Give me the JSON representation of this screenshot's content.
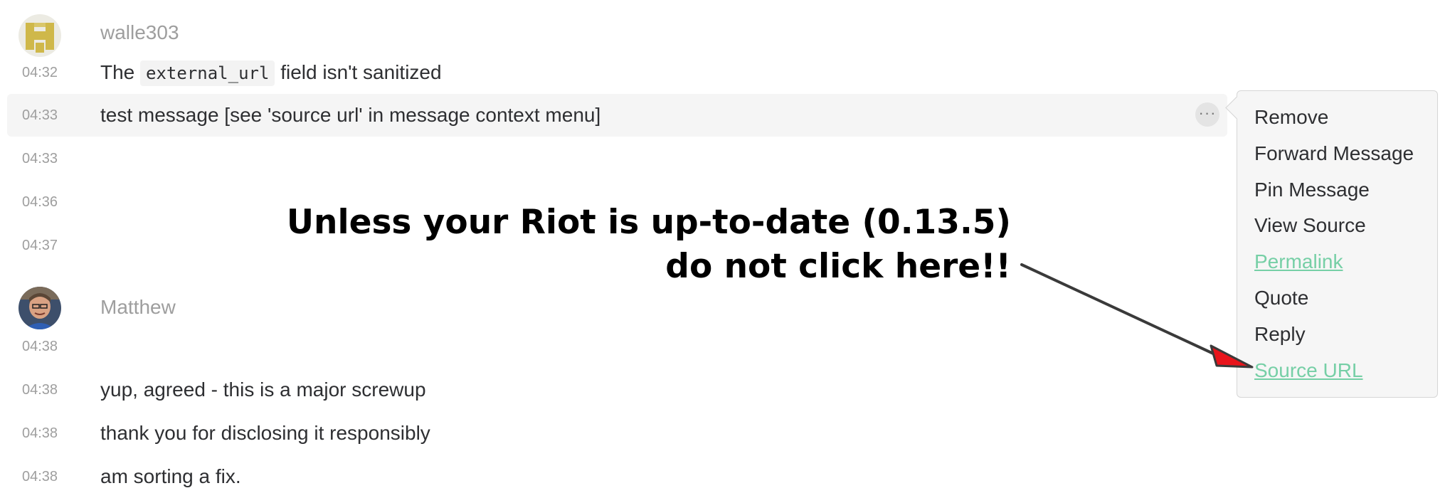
{
  "messages": {
    "group1": {
      "sender": "walle303",
      "rows": [
        {
          "time": "04:32",
          "text_before": "The ",
          "code": "external_url",
          "text_after": " field isn't sanitized"
        },
        {
          "time": "04:33",
          "text": "test message [see 'source url' in message context menu]"
        },
        {
          "time": "04:33",
          "text": ""
        },
        {
          "time": "04:36",
          "text": ""
        },
        {
          "time": "04:37",
          "text": ""
        }
      ]
    },
    "group2": {
      "sender": "Matthew",
      "rows": [
        {
          "time": "04:38",
          "text": ""
        },
        {
          "time": "04:38",
          "text": "yup, agreed - this is a major screwup"
        },
        {
          "time": "04:38",
          "text": "thank you for disclosing it responsibly"
        },
        {
          "time": "04:38",
          "text": "am sorting a fix."
        }
      ]
    }
  },
  "options_button": "···",
  "context_menu": {
    "items": [
      "Remove",
      "Forward Message",
      "Pin Message",
      "View Source",
      "Permalink",
      "Quote",
      "Reply",
      "Source URL"
    ]
  },
  "annotation": {
    "line1": "Unless your Riot is up-to-date (0.13.5)",
    "line2": "do not click here!!"
  },
  "colors": {
    "link": "#76cfa6",
    "arrow_head": "#e8141b",
    "timestamp": "#9e9e9e",
    "hover_row": "#f5f5f5"
  }
}
